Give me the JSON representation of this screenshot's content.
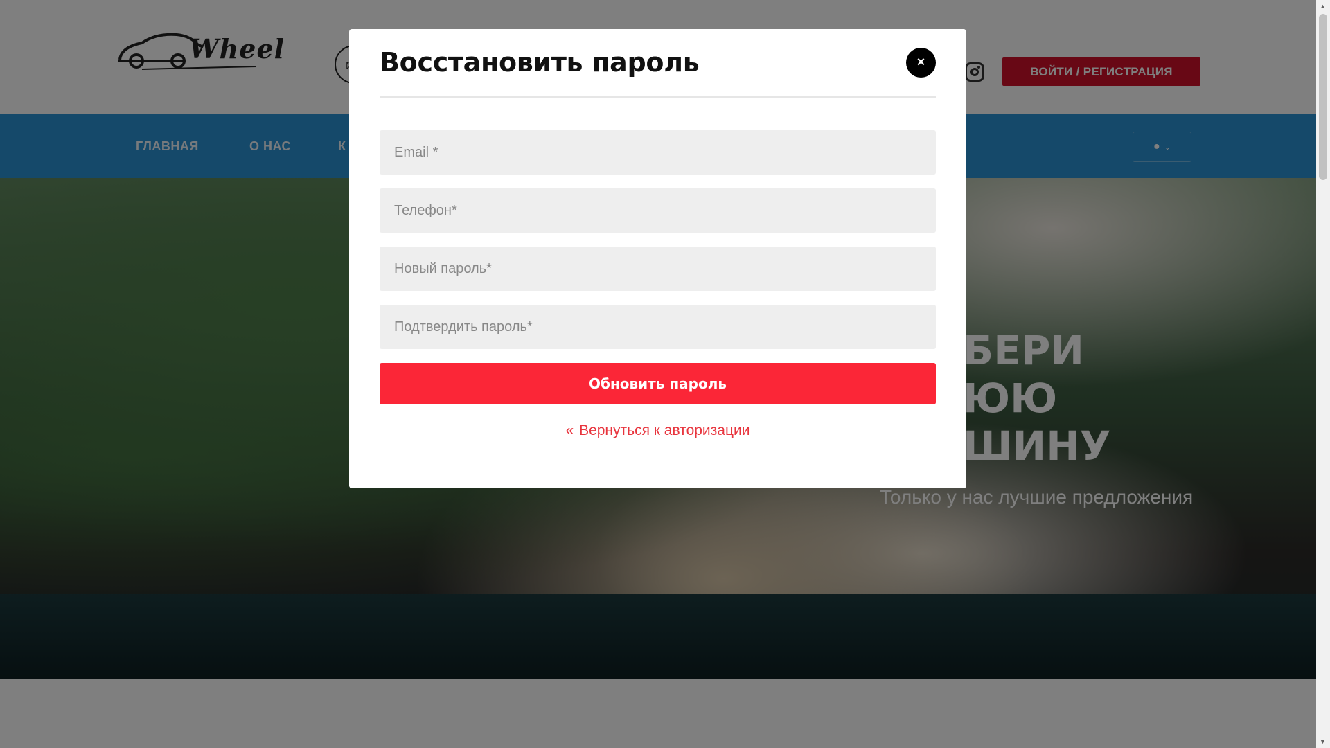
{
  "header": {
    "logo_text": "Wheel",
    "login_button": "ВОЙТИ / РЕГИСТРАЦИЯ"
  },
  "nav": {
    "items": [
      "ГЛАВНАЯ",
      "О НАС",
      "К"
    ]
  },
  "hero": {
    "title_lines": [
      "БЕРИ",
      "ЮЮ",
      "ШИНУ"
    ],
    "subtitle": "Только у нас лучшие предложения"
  },
  "modal": {
    "title": "Восстановить пароль",
    "close_label": "×",
    "fields": {
      "email": "Email *",
      "phone": "Телефон*",
      "new_password": "Новый пароль*",
      "confirm_password": "Подтвердить пароль*"
    },
    "submit_label": "Обновить пароль",
    "back_chevron": "«",
    "back_label": "Вернуться к авторизации"
  },
  "colors": {
    "primary_red": "#fb2637",
    "brand_red": "#d0112b",
    "nav_blue": "#2b93d4"
  },
  "icons": {
    "contact": "mail-icon",
    "instagram": "instagram-icon",
    "user": "user-circle-icon",
    "dropdown": "chevron-down-icon",
    "close": "close-icon"
  }
}
